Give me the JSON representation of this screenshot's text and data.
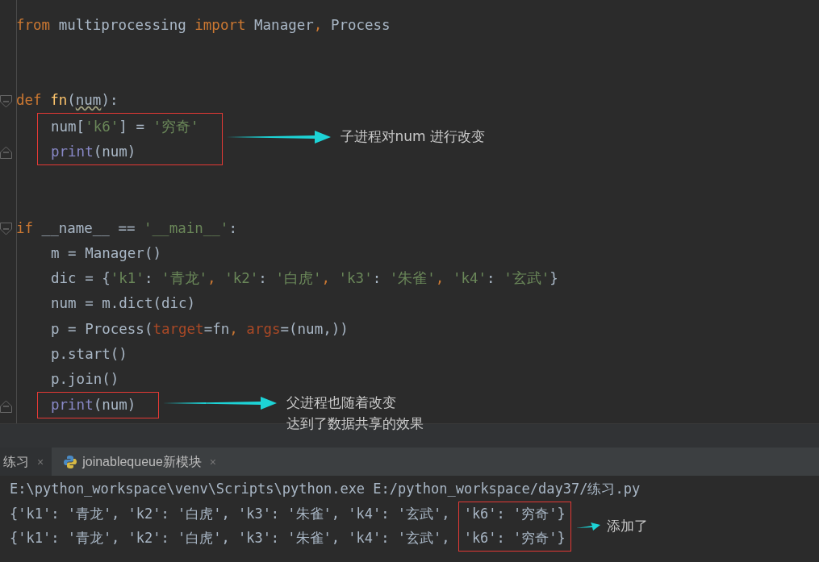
{
  "editor": {
    "blocks": [
      {
        "kind": "line",
        "tokens": [
          {
            "kind": "keyword",
            "text": "from"
          },
          {
            "kind": "plain",
            "text": " multiprocessing "
          },
          {
            "kind": "keyword",
            "text": "import"
          },
          {
            "kind": "plain",
            "text": " Manager"
          },
          {
            "kind": "keyword",
            "text": ","
          },
          {
            "kind": "plain",
            "text": " Process"
          }
        ]
      },
      {
        "kind": "blank"
      },
      {
        "kind": "blank"
      },
      {
        "kind": "line",
        "fold_start": true,
        "tokens": [
          {
            "kind": "keyword",
            "text": "def "
          },
          {
            "kind": "function",
            "text": "fn"
          },
          {
            "kind": "plain",
            "text": "("
          },
          {
            "kind": "warning",
            "text": "num"
          },
          {
            "kind": "plain",
            "text": "):"
          }
        ]
      },
      {
        "kind": "callout",
        "note": [
          "子进程对num 进行改变"
        ],
        "lines": [
          {
            "tokens": [
              {
                "kind": "plain",
                "text": "num["
              },
              {
                "kind": "string",
                "text": "'k6'"
              },
              {
                "kind": "plain",
                "text": "] = "
              },
              {
                "kind": "string",
                "text": "'穷奇'"
              }
            ]
          },
          {
            "fold_end": true,
            "tokens": [
              {
                "kind": "builtin",
                "text": "print"
              },
              {
                "kind": "plain",
                "text": "(num)"
              }
            ]
          }
        ]
      },
      {
        "kind": "blank"
      },
      {
        "kind": "blank"
      },
      {
        "kind": "line",
        "fold_start": true,
        "tokens": [
          {
            "kind": "keyword",
            "text": "if"
          },
          {
            "kind": "plain",
            "text": " __name__ == "
          },
          {
            "kind": "string",
            "text": "'__main__'"
          },
          {
            "kind": "plain",
            "text": ":"
          }
        ]
      },
      {
        "kind": "line",
        "indent": true,
        "tokens": [
          {
            "kind": "plain",
            "text": "m = Manager()"
          }
        ]
      },
      {
        "kind": "line",
        "indent": true,
        "tokens": [
          {
            "kind": "plain",
            "text": "dic = {"
          },
          {
            "kind": "string",
            "text": "'k1'"
          },
          {
            "kind": "plain",
            "text": ": "
          },
          {
            "kind": "string",
            "text": "'青龙'"
          },
          {
            "kind": "keyword",
            "text": ", "
          },
          {
            "kind": "string",
            "text": "'k2'"
          },
          {
            "kind": "plain",
            "text": ": "
          },
          {
            "kind": "string",
            "text": "'白虎'"
          },
          {
            "kind": "keyword",
            "text": ", "
          },
          {
            "kind": "string",
            "text": "'k3'"
          },
          {
            "kind": "plain",
            "text": ": "
          },
          {
            "kind": "string",
            "text": "'朱雀'"
          },
          {
            "kind": "keyword",
            "text": ", "
          },
          {
            "kind": "string",
            "text": "'k4'"
          },
          {
            "kind": "plain",
            "text": ": "
          },
          {
            "kind": "string",
            "text": "'玄武'"
          },
          {
            "kind": "plain",
            "text": "}"
          }
        ]
      },
      {
        "kind": "line",
        "indent": true,
        "tokens": [
          {
            "kind": "plain",
            "text": "num = m.dict(dic)"
          }
        ]
      },
      {
        "kind": "line",
        "indent": true,
        "tokens": [
          {
            "kind": "plain",
            "text": "p = Process("
          },
          {
            "kind": "param",
            "text": "target"
          },
          {
            "kind": "plain",
            "text": "=fn"
          },
          {
            "kind": "keyword",
            "text": ", "
          },
          {
            "kind": "param",
            "text": "args"
          },
          {
            "kind": "plain",
            "text": "=(num,))"
          }
        ]
      },
      {
        "kind": "line",
        "indent": true,
        "tokens": [
          {
            "kind": "plain",
            "text": "p.start()"
          }
        ]
      },
      {
        "kind": "line",
        "indent": true,
        "tokens": [
          {
            "kind": "plain",
            "text": "p.join()"
          }
        ]
      },
      {
        "kind": "callout",
        "note": [
          "父进程也随着改变",
          "达到了数据共享的效果"
        ],
        "lines": [
          {
            "fold_end": true,
            "tokens": [
              {
                "kind": "builtin",
                "text": "print"
              },
              {
                "kind": "plain",
                "text": "(num)"
              }
            ]
          }
        ]
      }
    ]
  },
  "run_tabs": [
    {
      "label": "练习",
      "close": "×",
      "selected": true,
      "icon": false
    },
    {
      "label": "joinablequeue新模块",
      "close": "×",
      "selected": false,
      "icon": true
    }
  ],
  "console": {
    "command": "E:\\python_workspace\\venv\\Scripts\\python.exe E:/python_workspace/day37/练习.py",
    "outputs": [
      {
        "text": "{'k1': '青龙', 'k2': '白虎', 'k3': '朱雀', 'k4': '玄武', ",
        "boxed": "'k6': '穷奇'}"
      },
      {
        "text": "{'k1': '青龙', 'k2': '白虎', 'k3': '朱雀', 'k4': '玄武', ",
        "boxed": "'k6': '穷奇'}"
      }
    ],
    "note": "添加了"
  }
}
